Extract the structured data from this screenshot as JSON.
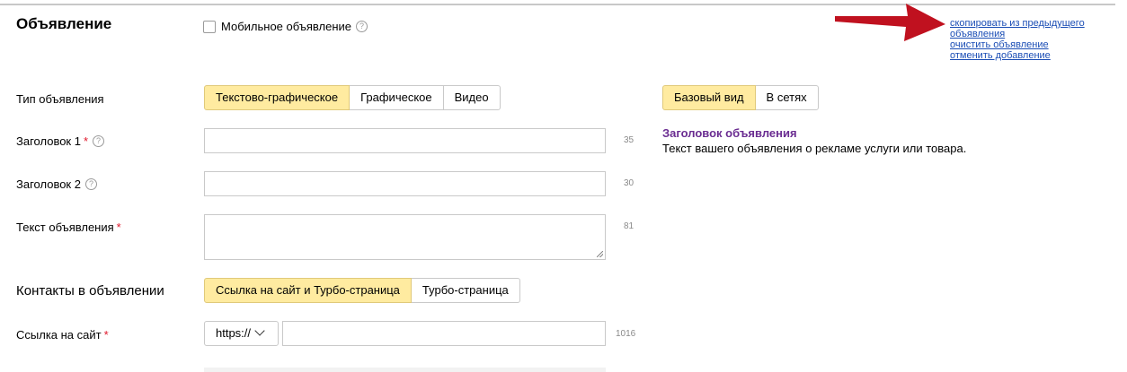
{
  "header": {
    "title": "Объявление",
    "mobile_label": "Мобильное объявление"
  },
  "actions": {
    "copy_line1": "скопировать из предыдущего",
    "copy_line2": "объявления",
    "clear": "очистить объявление",
    "cancel": "отменить добавление"
  },
  "ad_type": {
    "label": "Тип объявления",
    "options": [
      "Текстово-графическое",
      "Графическое",
      "Видео"
    ],
    "selected": "Текстово-графическое"
  },
  "preview": {
    "tabs": [
      "Базовый вид",
      "В сетях"
    ],
    "selected": "Базовый вид",
    "title": "Заголовок объявления",
    "text": "Текст вашего объявления о рекламе услуги или товара."
  },
  "fields": {
    "title1": {
      "label": "Заголовок 1",
      "value": "",
      "counter": "35"
    },
    "title2": {
      "label": "Заголовок 2",
      "value": "",
      "counter": "30"
    },
    "text": {
      "label": "Текст объявления",
      "value": "",
      "counter": "81"
    }
  },
  "contacts": {
    "label": "Контакты в объявлении",
    "options": [
      "Ссылка на сайт и Турбо-страница",
      "Турбо-страница"
    ],
    "selected": "Ссылка на сайт и Турбо-страница"
  },
  "site_link": {
    "label": "Ссылка на сайт",
    "protocol": "https://",
    "value": "",
    "counter": "1016"
  },
  "symbols": {
    "required": "*",
    "help": "?"
  },
  "colors": {
    "accent_yellow": "#ffeba0",
    "link_blue": "#1a4db5",
    "preview_purple": "#6a2c91",
    "required_red": "#e0172b",
    "arrow_red": "#c0111f"
  },
  "icons": [
    "help-icon",
    "chevron-down-icon",
    "red-arrow-annotation"
  ]
}
